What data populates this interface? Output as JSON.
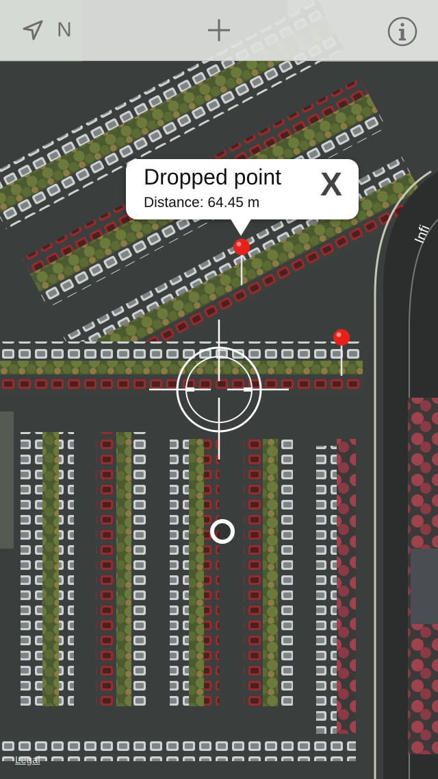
{
  "toolbar": {
    "compass_label": "N",
    "locate_icon": "location-arrow-icon",
    "add_icon": "plus-icon",
    "info_icon": "info-icon"
  },
  "callout": {
    "title": "Dropped point",
    "subtitle": "Distance: 64.45 m",
    "close_label": "X"
  },
  "map": {
    "style": "satellite",
    "road_label": "Infi",
    "legal_link": "Legal"
  },
  "pins": [
    {
      "name": "dropped-pin-1",
      "color": "#e8201a"
    },
    {
      "name": "dropped-pin-2",
      "color": "#e8201a"
    }
  ],
  "colors": {
    "toolbar_bg": "#e0e2e0",
    "toolbar_icon": "#6d6d6d",
    "pin_red": "#e8201a",
    "crosshair": "#ffffff"
  }
}
